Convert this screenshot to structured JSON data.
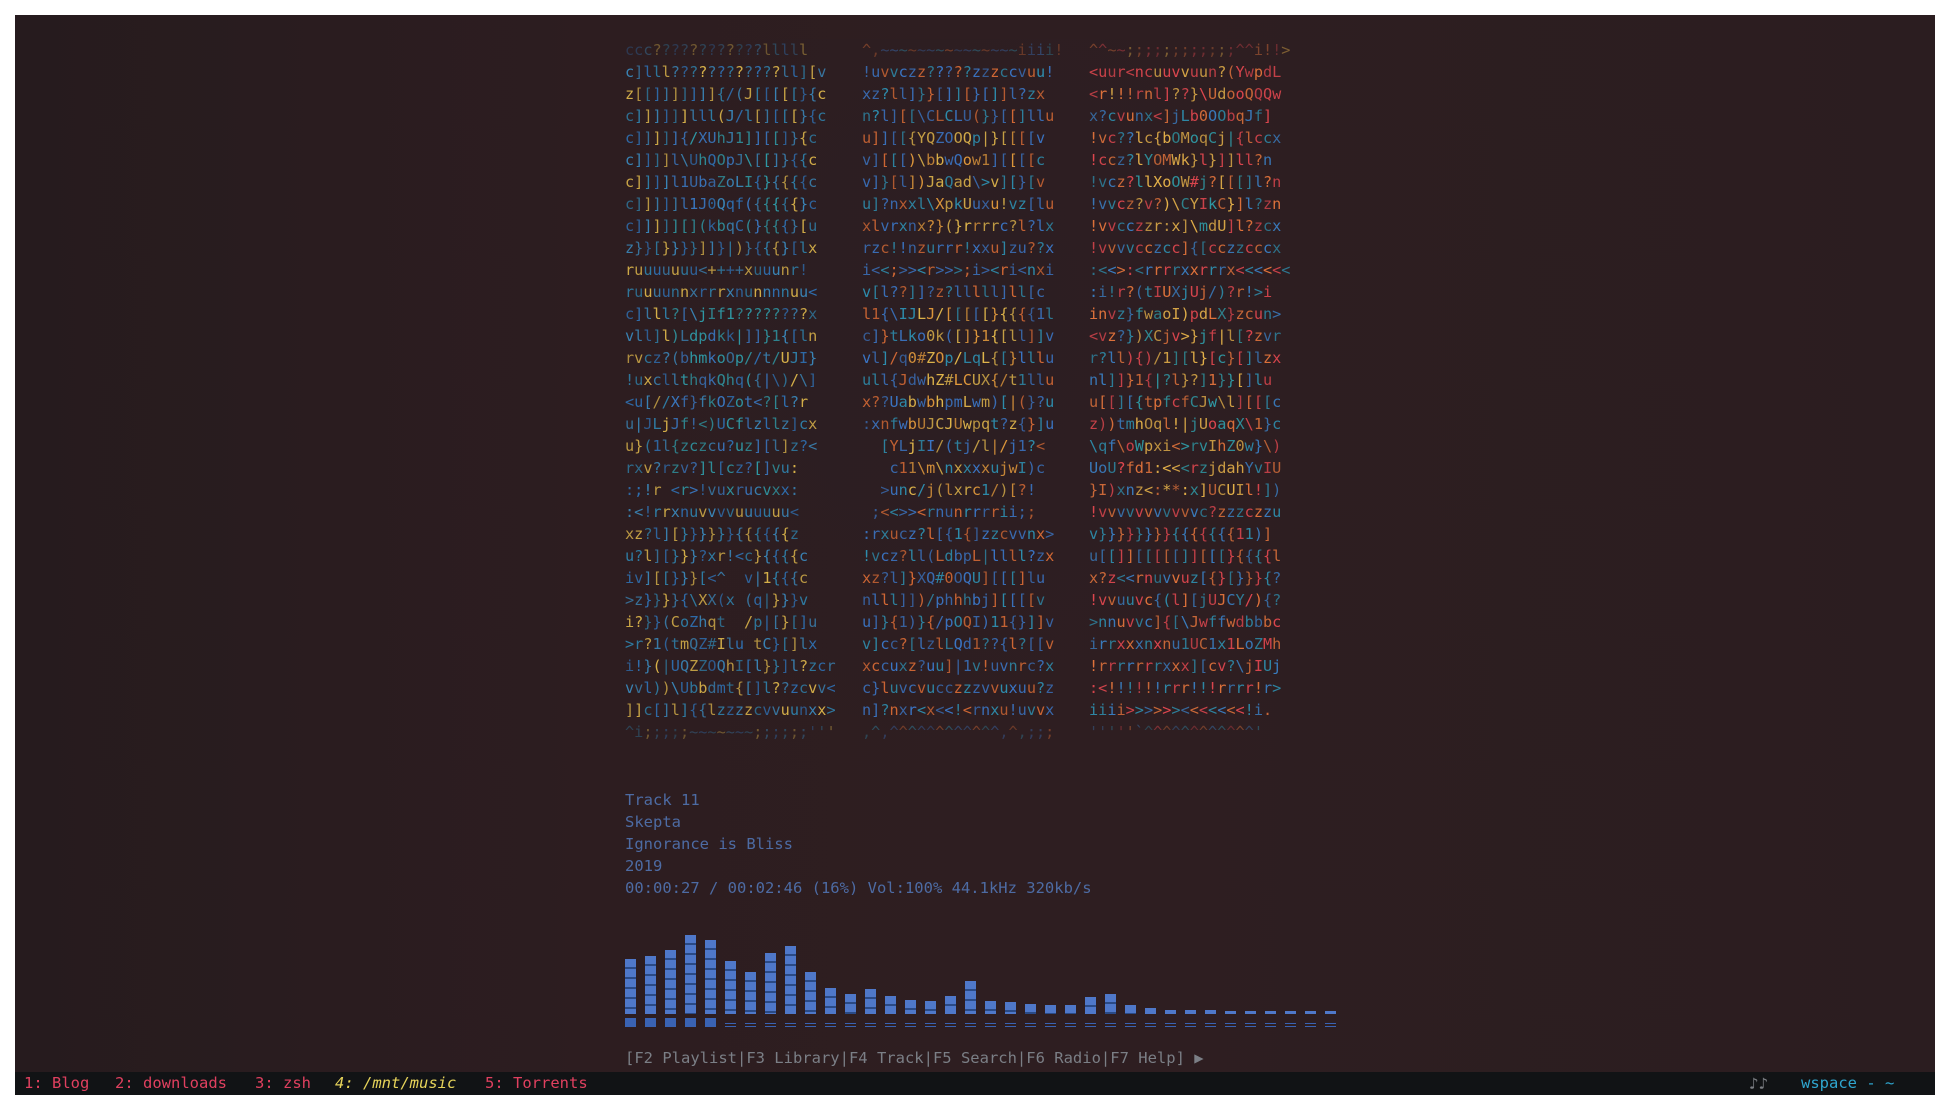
{
  "cover_ascii": {
    "columns": [
      {
        "lines": [
          "ccc????????????lllll",
          "c]lll????????????ll][v",
          "z[[]]]]]]]{/(J[[[[[}{c",
          "c]]]]]]lll(J/l[][[[}{c",
          "c]]]]]{/XUhJ1]][[]}{c",
          "c]]]]l\\UhQOpJ\\[[]}{{c",
          "c]]]]l1UbaZoLI{}{{{{c",
          "c]]]]]l1J0Qqf({{{{{}c",
          "c]]]]][](kbqC(}{{{}[u",
          "z}}[}}}}]]}|)}{{{}[lx",
          "ruuuuuuu<++++xuuunr!",
          "ruuuunnxrrrxnunnnnuu<",
          "c]lll?[\\jIf1????????x",
          "vll]l)Ldpdkk|]]}1{[ln",
          "rvcz?(bhmkoOp//t/UJI}",
          "!uxcllthqkQhq({|\\)/\\]",
          "<u[//Xf}fkOZot<?[l?r",
          "u|JLjJf!<)UCflzllz]cx",
          "u}(1l{zczcu?uz][l]z?<",
          "rxv?rzv?]l[cz?[]vu:",
          ":;!r <r>!vuxrucvxx:",
          ":<!rrxnuvvvvuuuuuu<",
          "xz?l][}}}}}}{{{{{{z",
          "u?l][}}}?xr!<c}{{{{c",
          "iv][[}}}[<^  v|1{{{c",
          ">z}}}}{\\XX(x (q|}}}v",
          "i?}}(CoZhqt  /p|[}[]u",
          ">r?1(tmQZ#Ilu tC}[]lx",
          "i!}(|UQZZOQhI[l}}]l?zcr",
          "vvl))\\Ubbdmt{[]l??zcvv<",
          "]]c[]l]{{lzzzzcvvuunxx>",
          "^i;;;;;~~~~~~~;;;;;;'''"
        ]
      },
      {
        "lines": [
          "^,~~~~~~~~~~~~~~~iiii!",
          "!uvvczz?????zzzccvuu!",
          "xz?ll]}}[]][}[]]l?zx",
          "n?l][[\\CLCLU(}}[[]llu",
          "u]][[{YQZOOQp|}[[[[v",
          "v][[[)\\bbwQow1][[[[c",
          "v]}[l])JaQad\\>v][}[v",
          "u]?nxxl\\XpkUuxu!vz[lu",
          "xlvrxnx?}(}rrrrc?l?lx",
          "rzc!!nzurrr!xxu]zu??x",
          "i<<;>><r>>>;i><ri<nxi",
          "v[l??]]?z?lllll]ll[c",
          "l1{\\IJLJ/[[[[[}{{{{1l",
          "c]}tLko0k([]}1{[ll]]v",
          "vl]/q0#ZOp/LqL{[}lllu",
          "ull{JdwhZ#LCUX{/t1llu",
          "x??UabwbhpmLwm)[|(}?u",
          ":xnfwbUJCJUwpqt?z{}]u",
          "  [YLjII/(tj/l|/j1?<",
          "   c11\\m\\nxxxxujwI)c",
          "  >unc/j(lxrc1/)[?!",
          " ;<<>><rnunrrrrii;;",
          ":rxucz?l[{1{]zzcvvnx>",
          "!vcz?ll(LdbpL|llll?zx",
          "xz?l]}XQ#0OQU][[[]lu",
          "nlll]])/phhhbj][[[[v",
          "u]}{1)}{/pOQI)11{}]]v",
          "v]cc?[lzlLQd1??{l?[[v",
          "xccuxz?uu]|1v!uvnrc?x",
          "c}luvcvucczzzvvuxuu?z",
          "n]?nxr<x<<!<rnxu!uvvx",
          ",^,^^^^^^^^^^^^,^,;;;"
        ]
      },
      {
        "lines": [
          "^^~~;;;;;;;;;;;;^^i!!>",
          "<uur<ncuuvvuun?(YwpdL",
          "<r!!!rnl]??}\\UdooQQQw",
          "x?cvunx<]jLb0OObqJf]",
          "!vc??lc{bOMoqCj|{lccx",
          "!ccz?lYOMWk}l}]]ll?n",
          "!vcz?llXoOW#j?[[[]l?n",
          "!vvcz?v?)\\CYIkC}]l?zn",
          "!vvcczzr:x]\\mdU]l?zcx",
          "!vvvvcczcc]{[cczzcccx",
          ":<<>:<rrrrxxrrrx<<<<<<",
          ":i!r?(tIUXjUj/)?r!>i",
          "invz}fwaoI)pdLX}zcun>",
          "<vz?})XCjv>}jf|l[?zvr",
          "r?ll){)/1][l}[c}[]lzx",
          "nl]]}1{|?l}?]1}}[]lu",
          "u[[][{tpfcfCJw\\l][[[c",
          "z))tmhOql!|jUoaqX\\1}c",
          "\\qf\\oWpxi<>rvIhZ0w}\\)",
          "UoU?fd1:<<<rzjdahYvIU",
          "}I)xnz<:**:x]UCUIl!])",
          "!vvvvvvvvvvvc?zzzczzu",
          "v}}}}}}}}{{{{{{{11)]",
          "u[[]][[[[[]][[[}{{{{l",
          "x?z<<rnuvvuz[{}[}}}{?",
          "!vvuuvc{(l][jUJCY/){?",
          ">nnuvvc]{[\\Jwffwdbbbc",
          "irrxxxnxnu1UC1x1LoZMh",
          "!rrrrrrrxxx][cv?\\jIUj",
          ":<!!!!!!rrr!!!rrrr!r>",
          "iiii>>>>>><<<<<<<!i.",
          "'''''`^^^^^^^^^^^^'"
        ]
      }
    ]
  },
  "now_playing": {
    "title": "Track 11",
    "artist": "Skepta",
    "album": "Ignorance is Bliss",
    "year": "2019",
    "progress_line": "00:00:27 / 00:02:46 (16%) Vol:100% 44.1kHz 320kb/s",
    "elapsed": "00:00:27",
    "duration": "00:02:46",
    "progress_percent": 16,
    "volume_percent": 100,
    "sample_rate": "44.1kHz",
    "bitrate": "320kb/s"
  },
  "visualizer": {
    "levels": [
      0.6,
      0.63,
      0.7,
      0.86,
      0.8,
      0.58,
      0.46,
      0.66,
      0.74,
      0.46,
      0.28,
      0.22,
      0.27,
      0.2,
      0.15,
      0.14,
      0.2,
      0.36,
      0.14,
      0.13,
      0.11,
      0.1,
      0.1,
      0.18,
      0.22,
      0.1,
      0.06,
      0.04,
      0.04,
      0.04,
      0.03,
      0.02,
      0.02,
      0.03,
      0.03,
      0.03
    ],
    "colors": {
      "light": "#4f78c9",
      "dark": "#2a4a86",
      "base": "#3a63b3"
    }
  },
  "function_keys": {
    "text": "[F2 Playlist|F3 Library|F4 Track|F5 Search|F6 Radio|F7 Help] ▶"
  },
  "statusbar": {
    "workspaces": [
      {
        "label": "1: Blog",
        "active": false
      },
      {
        "label": "2: downloads",
        "active": false
      },
      {
        "label": "3: zsh",
        "active": false
      },
      {
        "label": "4: /mnt/music",
        "active": true
      },
      {
        "label": "5: Torrents",
        "active": false
      }
    ],
    "music_icon": "♪♪",
    "right_text": "wspace - ~",
    "colors": {
      "inactive": "#e0405f",
      "active": "#e6d35a",
      "right": "#2fa6cf"
    }
  }
}
